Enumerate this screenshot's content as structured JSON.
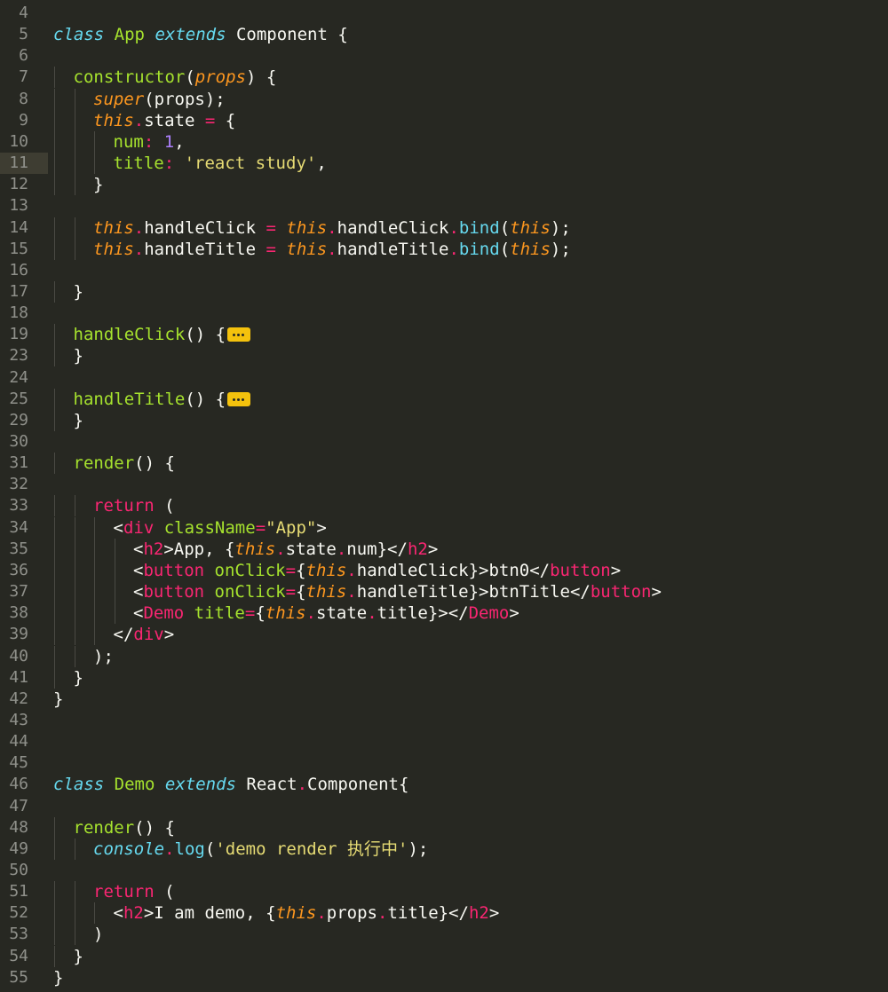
{
  "editor": {
    "theme_colors": {
      "background": "#272822",
      "keyword": "#f92672",
      "storage": "#66d9ef",
      "function": "#a6e22e",
      "parameter": "#fd971f",
      "number": "#ae81ff",
      "string": "#e6db74",
      "fold_marker": "#f4c20d"
    },
    "active_line": 11,
    "lines": [
      {
        "n": "4",
        "tokens": []
      },
      {
        "n": "5",
        "tokens": [
          {
            "t": "class",
            "c": "st"
          },
          {
            "t": " "
          },
          {
            "t": "App",
            "c": "fn"
          },
          {
            "t": " "
          },
          {
            "t": "extends",
            "c": "st"
          },
          {
            "t": " Component {"
          }
        ]
      },
      {
        "n": "6",
        "tokens": []
      },
      {
        "n": "7",
        "indent": 1,
        "tokens": [
          {
            "t": "constructor",
            "c": "fn"
          },
          {
            "t": "("
          },
          {
            "t": "props",
            "c": "pa"
          },
          {
            "t": ") {"
          }
        ]
      },
      {
        "n": "8",
        "indent": 2,
        "tokens": [
          {
            "t": "super",
            "c": "kwi"
          },
          {
            "t": "(props);"
          }
        ]
      },
      {
        "n": "9",
        "indent": 2,
        "tokens": [
          {
            "t": "this",
            "c": "kwi"
          },
          {
            "t": ".",
            "c": "kw"
          },
          {
            "t": "state "
          },
          {
            "t": "=",
            "c": "kw"
          },
          {
            "t": " {"
          }
        ]
      },
      {
        "n": "10",
        "indent": 3,
        "tokens": [
          {
            "t": "num",
            "c": "fn"
          },
          {
            "t": ":",
            "c": "kw"
          },
          {
            "t": " "
          },
          {
            "t": "1",
            "c": "num"
          },
          {
            "t": ","
          }
        ]
      },
      {
        "n": "11",
        "indent": 3,
        "tokens": [
          {
            "t": "title",
            "c": "fn"
          },
          {
            "t": ":",
            "c": "kw"
          },
          {
            "t": " "
          },
          {
            "t": "'react study'",
            "c": "str"
          },
          {
            "t": ","
          }
        ]
      },
      {
        "n": "12",
        "indent": 2,
        "tokens": [
          {
            "t": "}"
          }
        ]
      },
      {
        "n": "13",
        "tokens": []
      },
      {
        "n": "14",
        "indent": 2,
        "tokens": [
          {
            "t": "this",
            "c": "kwi"
          },
          {
            "t": ".",
            "c": "kw"
          },
          {
            "t": "handleClick "
          },
          {
            "t": "=",
            "c": "kw"
          },
          {
            "t": " "
          },
          {
            "t": "this",
            "c": "kwi"
          },
          {
            "t": ".",
            "c": "kw"
          },
          {
            "t": "handleClick"
          },
          {
            "t": ".",
            "c": "kw"
          },
          {
            "t": "bind",
            "c": "sup"
          },
          {
            "t": "("
          },
          {
            "t": "this",
            "c": "kwi"
          },
          {
            "t": ");"
          }
        ]
      },
      {
        "n": "15",
        "indent": 2,
        "tokens": [
          {
            "t": "this",
            "c": "kwi"
          },
          {
            "t": ".",
            "c": "kw"
          },
          {
            "t": "handleTitle "
          },
          {
            "t": "=",
            "c": "kw"
          },
          {
            "t": " "
          },
          {
            "t": "this",
            "c": "kwi"
          },
          {
            "t": ".",
            "c": "kw"
          },
          {
            "t": "handleTitle"
          },
          {
            "t": ".",
            "c": "kw"
          },
          {
            "t": "bind",
            "c": "sup"
          },
          {
            "t": "("
          },
          {
            "t": "this",
            "c": "kwi"
          },
          {
            "t": ");"
          }
        ]
      },
      {
        "n": "16",
        "tokens": []
      },
      {
        "n": "17",
        "indent": 1,
        "tokens": [
          {
            "t": "}"
          }
        ]
      },
      {
        "n": "18",
        "tokens": []
      },
      {
        "n": "19",
        "indent": 1,
        "tokens": [
          {
            "t": "handleClick",
            "c": "fn"
          },
          {
            "t": "() {"
          },
          {
            "fold": true
          }
        ]
      },
      {
        "n": "23",
        "indent": 1,
        "tokens": [
          {
            "t": "}"
          }
        ]
      },
      {
        "n": "24",
        "tokens": []
      },
      {
        "n": "25",
        "indent": 1,
        "tokens": [
          {
            "t": "handleTitle",
            "c": "fn"
          },
          {
            "t": "() {"
          },
          {
            "fold": true
          }
        ]
      },
      {
        "n": "29",
        "indent": 1,
        "tokens": [
          {
            "t": "}"
          }
        ]
      },
      {
        "n": "30",
        "tokens": []
      },
      {
        "n": "31",
        "indent": 1,
        "tokens": [
          {
            "t": "render",
            "c": "fn"
          },
          {
            "t": "() {"
          }
        ]
      },
      {
        "n": "32",
        "tokens": []
      },
      {
        "n": "33",
        "indent": 2,
        "tokens": [
          {
            "t": "return",
            "c": "kw"
          },
          {
            "t": " ("
          }
        ]
      },
      {
        "n": "34",
        "indent": 3,
        "tokens": [
          {
            "t": "<"
          },
          {
            "t": "div",
            "c": "kw"
          },
          {
            "t": " "
          },
          {
            "t": "className",
            "c": "fn"
          },
          {
            "t": "=",
            "c": "kw"
          },
          {
            "t": "\"App\"",
            "c": "str"
          },
          {
            "t": ">"
          }
        ]
      },
      {
        "n": "35",
        "indent": 4,
        "tokens": [
          {
            "t": "<"
          },
          {
            "t": "h2",
            "c": "kw"
          },
          {
            "t": ">App, {"
          },
          {
            "t": "this",
            "c": "kwi"
          },
          {
            "t": ".",
            "c": "kw"
          },
          {
            "t": "state"
          },
          {
            "t": ".",
            "c": "kw"
          },
          {
            "t": "num}</"
          },
          {
            "t": "h2",
            "c": "kw"
          },
          {
            "t": ">"
          }
        ]
      },
      {
        "n": "36",
        "indent": 4,
        "tokens": [
          {
            "t": "<"
          },
          {
            "t": "button",
            "c": "kw"
          },
          {
            "t": " "
          },
          {
            "t": "onClick",
            "c": "fn"
          },
          {
            "t": "=",
            "c": "kw"
          },
          {
            "t": "{"
          },
          {
            "t": "this",
            "c": "kwi"
          },
          {
            "t": ".",
            "c": "kw"
          },
          {
            "t": "handleClick}>btn0</"
          },
          {
            "t": "button",
            "c": "kw"
          },
          {
            "t": ">"
          }
        ]
      },
      {
        "n": "37",
        "indent": 4,
        "tokens": [
          {
            "t": "<"
          },
          {
            "t": "button",
            "c": "kw"
          },
          {
            "t": " "
          },
          {
            "t": "onClick",
            "c": "fn"
          },
          {
            "t": "=",
            "c": "kw"
          },
          {
            "t": "{"
          },
          {
            "t": "this",
            "c": "kwi"
          },
          {
            "t": ".",
            "c": "kw"
          },
          {
            "t": "handleTitle}>btnTitle</"
          },
          {
            "t": "button",
            "c": "kw"
          },
          {
            "t": ">"
          }
        ]
      },
      {
        "n": "38",
        "indent": 4,
        "tokens": [
          {
            "t": "<"
          },
          {
            "t": "Demo",
            "c": "kw"
          },
          {
            "t": " "
          },
          {
            "t": "title",
            "c": "fn"
          },
          {
            "t": "=",
            "c": "kw"
          },
          {
            "t": "{"
          },
          {
            "t": "this",
            "c": "kwi"
          },
          {
            "t": ".",
            "c": "kw"
          },
          {
            "t": "state"
          },
          {
            "t": ".",
            "c": "kw"
          },
          {
            "t": "title}></"
          },
          {
            "t": "Demo",
            "c": "kw"
          },
          {
            "t": ">"
          }
        ]
      },
      {
        "n": "39",
        "indent": 3,
        "tokens": [
          {
            "t": "</"
          },
          {
            "t": "div",
            "c": "kw"
          },
          {
            "t": ">"
          }
        ]
      },
      {
        "n": "40",
        "indent": 2,
        "tokens": [
          {
            "t": ");"
          }
        ]
      },
      {
        "n": "41",
        "indent": 1,
        "tokens": [
          {
            "t": "}"
          }
        ]
      },
      {
        "n": "42",
        "tokens": [
          {
            "t": "}"
          }
        ]
      },
      {
        "n": "43",
        "tokens": []
      },
      {
        "n": "44",
        "tokens": []
      },
      {
        "n": "45",
        "tokens": []
      },
      {
        "n": "46",
        "tokens": [
          {
            "t": "class",
            "c": "st"
          },
          {
            "t": " "
          },
          {
            "t": "Demo",
            "c": "fn"
          },
          {
            "t": " "
          },
          {
            "t": "extends",
            "c": "st"
          },
          {
            "t": " React"
          },
          {
            "t": ".",
            "c": "kw"
          },
          {
            "t": "Component{"
          }
        ]
      },
      {
        "n": "47",
        "tokens": []
      },
      {
        "n": "48",
        "indent": 1,
        "tokens": [
          {
            "t": "render",
            "c": "fn"
          },
          {
            "t": "() {"
          }
        ]
      },
      {
        "n": "49",
        "indent": 2,
        "tokens": [
          {
            "t": "console",
            "c": "st"
          },
          {
            "t": ".",
            "c": "kw"
          },
          {
            "t": "log",
            "c": "sup"
          },
          {
            "t": "("
          },
          {
            "t": "'demo render 执行中'",
            "c": "str"
          },
          {
            "t": ");"
          }
        ]
      },
      {
        "n": "50",
        "tokens": []
      },
      {
        "n": "51",
        "indent": 2,
        "tokens": [
          {
            "t": "return",
            "c": "kw"
          },
          {
            "t": " ("
          }
        ]
      },
      {
        "n": "52",
        "indent": 3,
        "tokens": [
          {
            "t": "<"
          },
          {
            "t": "h2",
            "c": "kw"
          },
          {
            "t": ">I am demo, {"
          },
          {
            "t": "this",
            "c": "kwi"
          },
          {
            "t": ".",
            "c": "kw"
          },
          {
            "t": "props"
          },
          {
            "t": ".",
            "c": "kw"
          },
          {
            "t": "title}</"
          },
          {
            "t": "h2",
            "c": "kw"
          },
          {
            "t": ">"
          }
        ]
      },
      {
        "n": "53",
        "indent": 2,
        "tokens": [
          {
            "t": ")"
          }
        ]
      },
      {
        "n": "54",
        "indent": 1,
        "tokens": [
          {
            "t": "}"
          }
        ]
      },
      {
        "n": "55",
        "tokens": [
          {
            "t": "}"
          }
        ]
      }
    ]
  }
}
